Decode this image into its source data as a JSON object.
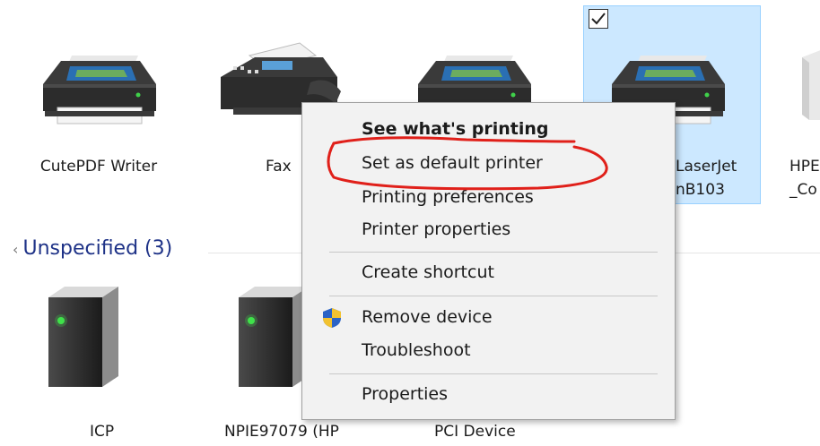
{
  "devices_printers": [
    {
      "label": "CutePDF Writer"
    },
    {
      "label": "Fax"
    },
    {
      "label": ""
    },
    {
      "label_line1": "LaserJet",
      "label_line2": "nB103",
      "selected": true
    },
    {
      "label_line1": "HPE",
      "label_line2": "_Co"
    }
  ],
  "group_unspecified": {
    "title": "Unspecified (3)"
  },
  "devices_unspecified": [
    {
      "label": "ICP"
    },
    {
      "label": "NPIE97079 (HP"
    },
    {
      "label": "PCI Device"
    }
  ],
  "context_menu": {
    "items": [
      "See what's printing",
      "Set as default printer",
      "Printing preferences",
      "Printer properties",
      "Create shortcut",
      "Remove device",
      "Troubleshoot",
      "Properties"
    ]
  },
  "colors": {
    "selection_bg": "#cce8ff",
    "selection_border": "#99d1ff",
    "group_header": "#1e3287",
    "annotation": "#e0201a"
  },
  "icons": {
    "printer": "printer-icon",
    "fax": "fax-icon",
    "tower": "computer-tower-icon",
    "uac_shield": "uac-shield-icon",
    "checkbox": "checkmark-icon"
  }
}
